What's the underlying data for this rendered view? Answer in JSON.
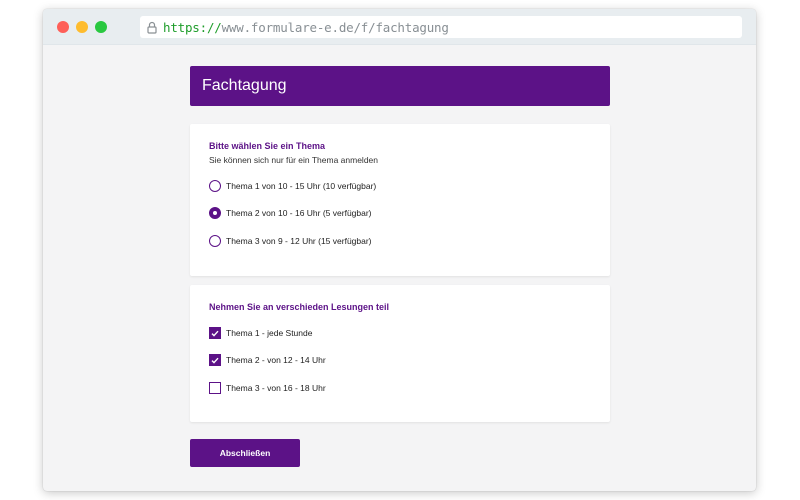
{
  "browser": {
    "url_scheme": "https://",
    "url_rest": "www.formulare-e.de/f/fachtagung"
  },
  "form": {
    "title": "Fachtagung",
    "section1": {
      "title": "Bitte wählen Sie ein Thema",
      "subtitle": "Sie können sich nur für ein Thema anmelden",
      "options": [
        {
          "label": "Thema 1 von 10 - 15 Uhr (10 verfügbar)",
          "checked": false
        },
        {
          "label": "Thema 2 von 10 - 16 Uhr (5 verfügbar)",
          "checked": true
        },
        {
          "label": "Thema 3 von 9 - 12 Uhr (15 verfügbar)",
          "checked": false
        }
      ]
    },
    "section2": {
      "title": "Nehmen Sie an verschieden Lesungen teil",
      "options": [
        {
          "label": "Thema 1 - jede Stunde",
          "checked": true
        },
        {
          "label": "Thema 2 - von 12 - 14 Uhr",
          "checked": true
        },
        {
          "label": "Thema 3 - von 16 - 18 Uhr",
          "checked": false
        }
      ]
    },
    "submit_label": "Abschließen"
  },
  "colors": {
    "accent": "#5c1287",
    "url_scheme": "#1f9d2b"
  }
}
